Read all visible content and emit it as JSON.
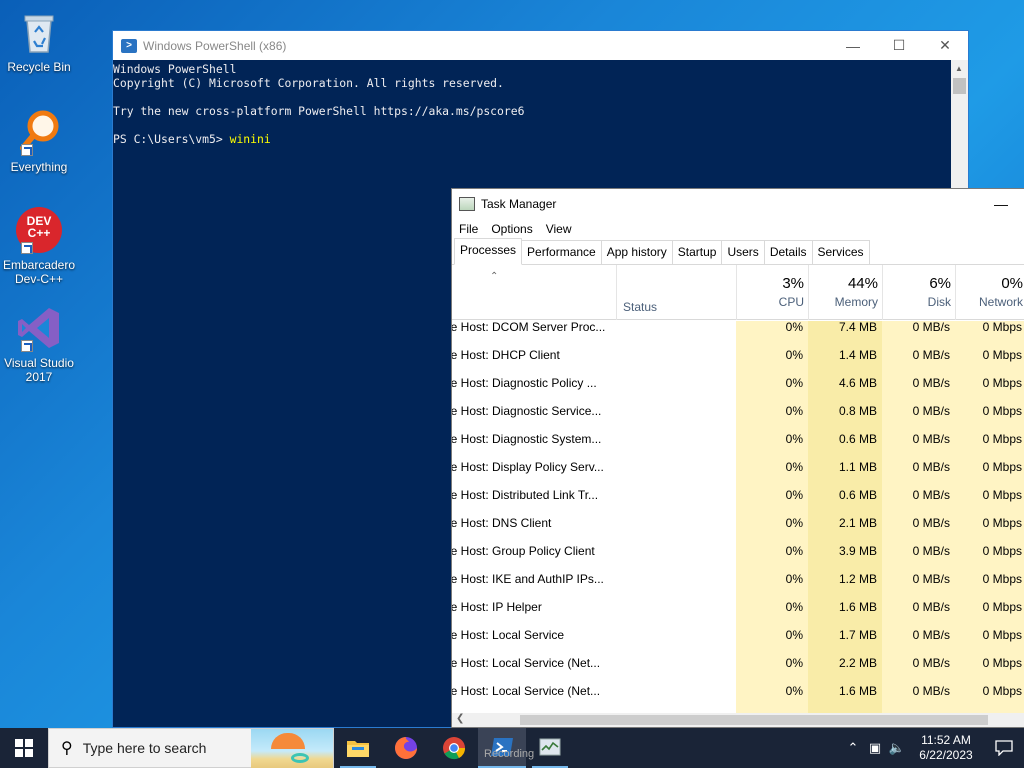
{
  "desktop": {
    "icons": [
      {
        "label": "Recycle Bin"
      },
      {
        "label": "Everything"
      },
      {
        "label": "Embarcadero Dev-C++",
        "logo_text": "DEV C++"
      },
      {
        "label": "Visual Studio 2017"
      }
    ]
  },
  "powershell": {
    "title": "Windows PowerShell (x86)",
    "lines": [
      "Windows PowerShell",
      "Copyright (C) Microsoft Corporation. All rights reserved.",
      "",
      "Try the new cross-platform PowerShell https://aka.ms/pscore6",
      ""
    ],
    "prompt": "PS C:\\Users\\vm5> ",
    "command": "winini",
    "colors": {
      "background": "#012456",
      "text": "#eeedf0",
      "command": "#ffff00"
    }
  },
  "taskmanager": {
    "title": "Task Manager",
    "menu": [
      "File",
      "Options",
      "View"
    ],
    "tabs": [
      "Processes",
      "Performance",
      "App history",
      "Startup",
      "Users",
      "Details",
      "Services"
    ],
    "active_tab": "Processes",
    "status_header": "Status",
    "columns": [
      {
        "pct": "3%",
        "label": "CPU"
      },
      {
        "pct": "44%",
        "label": "Memory"
      },
      {
        "pct": "6%",
        "label": "Disk"
      },
      {
        "pct": "0%",
        "label": "Network"
      }
    ],
    "rows": [
      {
        "name": "vice Host: DCOM Server Proc...",
        "cpu": "0%",
        "mem": "7.4 MB",
        "disk": "0 MB/s",
        "net": "0 Mbps"
      },
      {
        "name": "vice Host: DHCP Client",
        "cpu": "0%",
        "mem": "1.4 MB",
        "disk": "0 MB/s",
        "net": "0 Mbps"
      },
      {
        "name": "vice Host: Diagnostic Policy ...",
        "cpu": "0%",
        "mem": "4.6 MB",
        "disk": "0 MB/s",
        "net": "0 Mbps"
      },
      {
        "name": "vice Host: Diagnostic Service...",
        "cpu": "0%",
        "mem": "0.8 MB",
        "disk": "0 MB/s",
        "net": "0 Mbps"
      },
      {
        "name": "vice Host: Diagnostic System...",
        "cpu": "0%",
        "mem": "0.6 MB",
        "disk": "0 MB/s",
        "net": "0 Mbps"
      },
      {
        "name": "vice Host: Display Policy Serv...",
        "cpu": "0%",
        "mem": "1.1 MB",
        "disk": "0 MB/s",
        "net": "0 Mbps"
      },
      {
        "name": "vice Host: Distributed Link Tr...",
        "cpu": "0%",
        "mem": "0.6 MB",
        "disk": "0 MB/s",
        "net": "0 Mbps"
      },
      {
        "name": "vice Host: DNS Client",
        "cpu": "0%",
        "mem": "2.1 MB",
        "disk": "0 MB/s",
        "net": "0 Mbps"
      },
      {
        "name": "vice Host: Group Policy Client",
        "cpu": "0%",
        "mem": "3.9 MB",
        "disk": "0 MB/s",
        "net": "0 Mbps"
      },
      {
        "name": "vice Host: IKE and AuthIP IPs...",
        "cpu": "0%",
        "mem": "1.2 MB",
        "disk": "0 MB/s",
        "net": "0 Mbps"
      },
      {
        "name": "vice Host: IP Helper",
        "cpu": "0%",
        "mem": "1.6 MB",
        "disk": "0 MB/s",
        "net": "0 Mbps"
      },
      {
        "name": "vice Host: Local Service",
        "cpu": "0%",
        "mem": "1.7 MB",
        "disk": "0 MB/s",
        "net": "0 Mbps"
      },
      {
        "name": "vice Host: Local Service (Net...",
        "cpu": "0%",
        "mem": "2.2 MB",
        "disk": "0 MB/s",
        "net": "0 Mbps"
      },
      {
        "name": "vice Host: Local Service (Net...",
        "cpu": "0%",
        "mem": "1.6 MB",
        "disk": "0 MB/s",
        "net": "0 Mbps"
      }
    ]
  },
  "taskbar": {
    "search_placeholder": "Type here to search",
    "apps": [
      {
        "name": "file-explorer",
        "icon": "folder-icon"
      },
      {
        "name": "firefox",
        "icon": "firefox-icon"
      },
      {
        "name": "chrome",
        "icon": "chrome-icon"
      },
      {
        "name": "powershell",
        "icon": "powershell-icon"
      },
      {
        "name": "task-manager",
        "icon": "task-manager-icon"
      }
    ],
    "hover_text": "Recording",
    "clock_time": "11:52 AM",
    "clock_date": "6/22/2023"
  }
}
